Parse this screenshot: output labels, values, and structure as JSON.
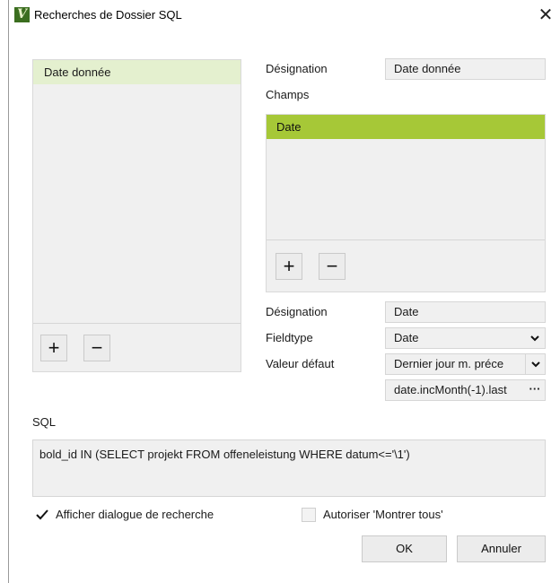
{
  "window": {
    "title": "Recherches de Dossier SQL",
    "app_icon": "v-logo-icon",
    "close_symbol": "✕"
  },
  "searches": {
    "items": [
      "Date donnée"
    ],
    "add_symbol": "+",
    "remove_symbol": "−"
  },
  "search_detail": {
    "designation_label": "Désignation",
    "designation_value": "Date donnée",
    "fields_label": "Champs",
    "fields": [
      "Date"
    ],
    "add_symbol": "+",
    "remove_symbol": "−"
  },
  "field_detail": {
    "designation_label": "Désignation",
    "designation_value": "Date",
    "fieldtype_label": "Fieldtype",
    "fieldtype_value": "Date",
    "default_label": "Valeur défaut",
    "default_value": "Dernier jour m. préce",
    "expression_value": "date.incMonth(-1).last",
    "expression_button": "···"
  },
  "sql": {
    "label": "SQL",
    "value": "bold_id IN (SELECT projekt FROM offeneleistung WHERE datum<='\\1')"
  },
  "options": {
    "show_dialog_label": "Afficher dialogue de recherche",
    "show_dialog_checked": true,
    "allow_show_all_label": "Autoriser 'Montrer tous'",
    "allow_show_all_checked": false
  },
  "buttons": {
    "ok": "OK",
    "cancel": "Annuler"
  },
  "colors": {
    "selected_field": "#a6c837",
    "selected_search": "#e4f0cf",
    "panel_bg": "#f0f0f0"
  }
}
